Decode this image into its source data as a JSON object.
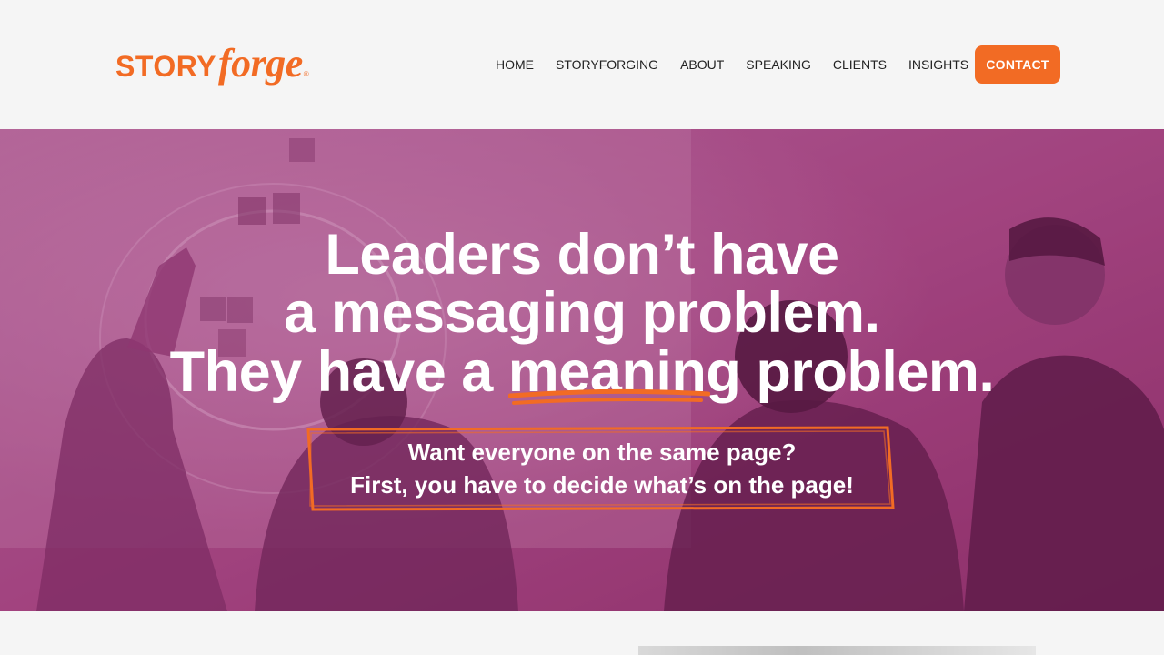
{
  "brand": {
    "logo_story": "STORY",
    "logo_forge": "forge",
    "logo_reg": "®",
    "orange": "#f26b24",
    "magenta": "#a23a7c"
  },
  "nav": {
    "items": [
      "HOME",
      "STORYFORGING",
      "ABOUT",
      "SPEAKING",
      "CLIENTS",
      "INSIGHTS"
    ],
    "contact_label": "CONTACT"
  },
  "hero": {
    "line1": "Leaders don’t have",
    "line2": "a messaging problem.",
    "line3_pre": "They have a ",
    "line3_emph": "meaning",
    "line3_post": " problem.",
    "sub1": "Want everyone on the same page?",
    "sub2": "First, you have to decide what’s on the page!"
  }
}
